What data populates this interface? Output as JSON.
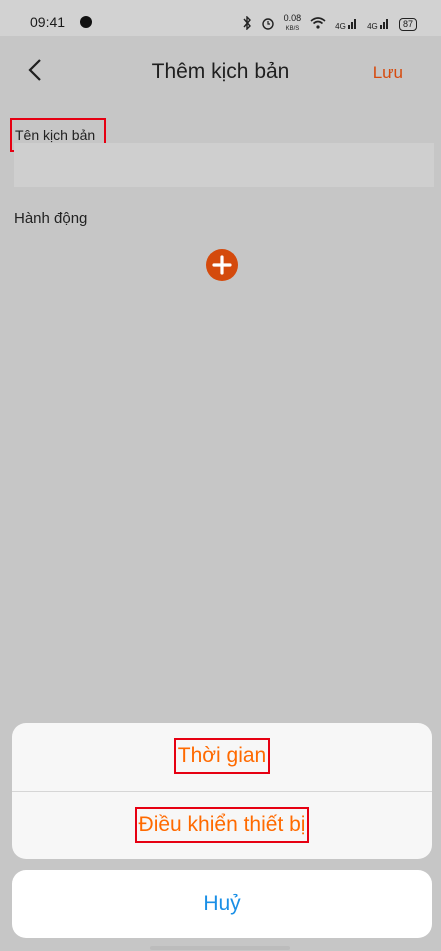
{
  "status_bar": {
    "time": "09:41",
    "net_speed": "0.08",
    "net_unit": "KB/S",
    "net1": "4G",
    "net2": "4G",
    "battery": "87"
  },
  "header": {
    "title": "Thêm kịch bản",
    "save_label": "Lưu"
  },
  "form": {
    "name_label": "Tên kịch bản",
    "name_value": "",
    "action_label": "Hành động"
  },
  "action_sheet": {
    "items": [
      "Thời gian",
      "Điều khiển thiết bị"
    ],
    "cancel_label": "Huỷ"
  },
  "colors": {
    "accent": "#d74a0d",
    "sheet_text": "#ff6a00",
    "cancel_text": "#1a8fe6",
    "highlight": "#e60012"
  }
}
